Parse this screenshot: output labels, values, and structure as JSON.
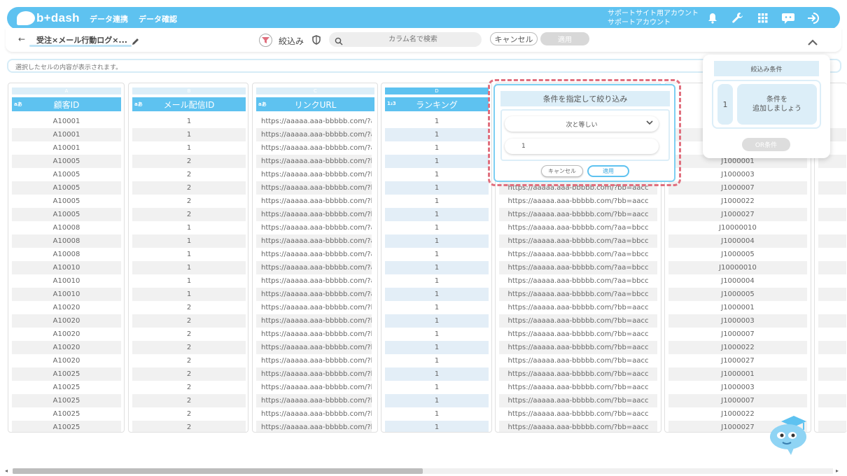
{
  "app": {
    "logo_text": "b+dash",
    "nav_items": [
      "データ連携",
      "データ確認"
    ],
    "support_account": [
      "サポートサイト用アカウント",
      "サポートアカウント"
    ]
  },
  "toolbar": {
    "title": "受注×メール行動ログ×...",
    "filter_label": "絞込み",
    "search_placeholder": "カラム名で検索",
    "cancel_label": "キャンセル",
    "apply_label": "適用"
  },
  "cell_display": {
    "placeholder": "選択したセルの内容が表示されます。"
  },
  "columns": [
    {
      "letter": "A",
      "name": "顧客ID",
      "type": "aあ",
      "values": [
        "A10001",
        "A10001",
        "A10001",
        "A10005",
        "A10005",
        "A10005",
        "A10005",
        "A10005",
        "A10008",
        "A10008",
        "A10008",
        "A10010",
        "A10010",
        "A10010",
        "A10020",
        "A10020",
        "A10020",
        "A10020",
        "A10020",
        "A10025",
        "A10025",
        "A10025",
        "A10025",
        "A10025"
      ]
    },
    {
      "letter": "B",
      "name": "メール配信ID",
      "type": "aあ",
      "values": [
        "1",
        "1",
        "1",
        "2",
        "2",
        "2",
        "2",
        "2",
        "1",
        "1",
        "1",
        "1",
        "1",
        "1",
        "2",
        "2",
        "2",
        "2",
        "2",
        "2",
        "2",
        "2",
        "2",
        "2"
      ]
    },
    {
      "letter": "C",
      "name": "リンクURL",
      "type": "aあ",
      "values": [
        "https://aaaaa.aaa-bbbbb.com/?aa...",
        "https://aaaaa.aaa-bbbbb.com/?aa...",
        "https://aaaaa.aaa-bbbbb.com/?aa...",
        "https://aaaaa.aaa-bbbbb.com/?bb...",
        "https://aaaaa.aaa-bbbbb.com/?bb...",
        "https://aaaaa.aaa-bbbbb.com/?bb...",
        "https://aaaaa.aaa-bbbbb.com/?bb...",
        "https://aaaaa.aaa-bbbbb.com/?bb...",
        "https://aaaaa.aaa-bbbbb.com/?aa...",
        "https://aaaaa.aaa-bbbbb.com/?aa...",
        "https://aaaaa.aaa-bbbbb.com/?aa...",
        "https://aaaaa.aaa-bbbbb.com/?aa...",
        "https://aaaaa.aaa-bbbbb.com/?aa...",
        "https://aaaaa.aaa-bbbbb.com/?aa...",
        "https://aaaaa.aaa-bbbbb.com/?bb...",
        "https://aaaaa.aaa-bbbbb.com/?bb...",
        "https://aaaaa.aaa-bbbbb.com/?bb...",
        "https://aaaaa.aaa-bbbbb.com/?bb...",
        "https://aaaaa.aaa-bbbbb.com/?bb...",
        "https://aaaaa.aaa-bbbbb.com/?bb...",
        "https://aaaaa.aaa-bbbbb.com/?bb...",
        "https://aaaaa.aaa-bbbbb.com/?bb...",
        "https://aaaaa.aaa-bbbbb.com/?bb...",
        "https://aaaaa.aaa-bbbbb.com/?bb..."
      ]
    },
    {
      "letter": "D",
      "name": "ランキング",
      "type": "1₂3",
      "values": [
        "1",
        "1",
        "1",
        "1",
        "1",
        "1",
        "1",
        "1",
        "1",
        "1",
        "1",
        "1",
        "1",
        "1",
        "1",
        "1",
        "1",
        "1",
        "1",
        "1",
        "1",
        "1",
        "1",
        "1"
      ]
    },
    {
      "letter": "",
      "name": "",
      "type": "",
      "values": [
        "",
        "",
        "",
        "",
        "",
        "https://aaaaa.aaa-bbbbb.com/?bb=aacc",
        "https://aaaaa.aaa-bbbbb.com/?bb=aacc",
        "https://aaaaa.aaa-bbbbb.com/?bb=aacc",
        "https://aaaaa.aaa-bbbbb.com/?aa=bbcc",
        "https://aaaaa.aaa-bbbbb.com/?aa=bbcc",
        "https://aaaaa.aaa-bbbbb.com/?aa=bbcc",
        "https://aaaaa.aaa-bbbbb.com/?aa=bbcc",
        "https://aaaaa.aaa-bbbbb.com/?aa=bbcc",
        "https://aaaaa.aaa-bbbbb.com/?aa=bbcc",
        "https://aaaaa.aaa-bbbbb.com/?bb=aacc",
        "https://aaaaa.aaa-bbbbb.com/?bb=aacc",
        "https://aaaaa.aaa-bbbbb.com/?bb=aacc",
        "https://aaaaa.aaa-bbbbb.com/?bb=aacc",
        "https://aaaaa.aaa-bbbbb.com/?bb=aacc",
        "https://aaaaa.aaa-bbbbb.com/?bb=aacc",
        "https://aaaaa.aaa-bbbbb.com/?bb=aacc",
        "https://aaaaa.aaa-bbbbb.com/?bb=aacc",
        "https://aaaaa.aaa-bbbbb.com/?bb=aacc",
        "https://aaaaa.aaa-bbbbb.com/?bb=aacc"
      ]
    },
    {
      "letter": "",
      "name": "",
      "type": "",
      "values": [
        "",
        "",
        "",
        "J1000001",
        "J1000003",
        "J1000007",
        "J1000022",
        "J1000027",
        "J10000010",
        "J1000004",
        "J1000005",
        "J10000010",
        "J1000004",
        "J1000005",
        "J1000001",
        "J1000003",
        "J1000007",
        "J1000022",
        "J1000027",
        "J1000001",
        "J1000003",
        "J1000007",
        "J1000022",
        "J1000027"
      ]
    }
  ],
  "filter_popup": {
    "title": "条件を指定して絞り込み",
    "operator": "次と等しい",
    "value": "1",
    "cancel_label": "キャンセル",
    "apply_label": "適用"
  },
  "conditions_panel": {
    "title": "絞込み条件",
    "index": "1",
    "message": "条件を\n追加しましょう",
    "or_label": "OR条件"
  },
  "colors": {
    "accent": "#5ec2f0",
    "highlight": "#e06f7e",
    "light": "#dceef8"
  }
}
